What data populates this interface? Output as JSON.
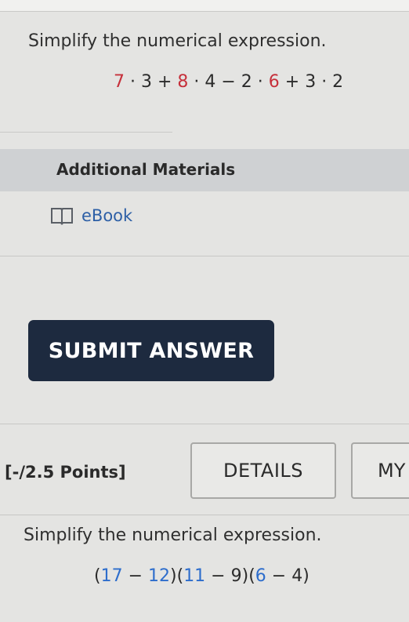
{
  "question1": {
    "prompt": "Simplify the numerical expression.",
    "expression": [
      {
        "text": "7",
        "color": "red"
      },
      {
        "text": " · 3 + ",
        "color": "dark"
      },
      {
        "text": "8",
        "color": "red"
      },
      {
        "text": " · 4 − 2 · ",
        "color": "dark"
      },
      {
        "text": "6",
        "color": "red"
      },
      {
        "text": " + 3 · 2",
        "color": "dark"
      }
    ]
  },
  "additional_materials": {
    "title": "Additional Materials",
    "ebook_label": "eBook",
    "icon": "book-icon"
  },
  "submit": {
    "label": "SUBMIT ANSWER"
  },
  "question2": {
    "points": "[-/2.5 Points]",
    "details_label": "DETAILS",
    "my_label": "MY",
    "prompt": "Simplify the numerical expression.",
    "expression": [
      {
        "text": "(",
        "color": "dark"
      },
      {
        "text": "17",
        "color": "blue"
      },
      {
        "text": " − ",
        "color": "dark"
      },
      {
        "text": "12",
        "color": "blue"
      },
      {
        "text": ")(",
        "color": "dark"
      },
      {
        "text": "11",
        "color": "blue"
      },
      {
        "text": " − 9)(",
        "color": "dark"
      },
      {
        "text": "6",
        "color": "blue"
      },
      {
        "text": " − 4)",
        "color": "dark"
      }
    ]
  },
  "colors": {
    "red": "#c6303b",
    "blue": "#2d6dcc",
    "dark": "#2b2b2b",
    "submit_bg": "#1d2a3f",
    "link": "#2d5fa6"
  }
}
